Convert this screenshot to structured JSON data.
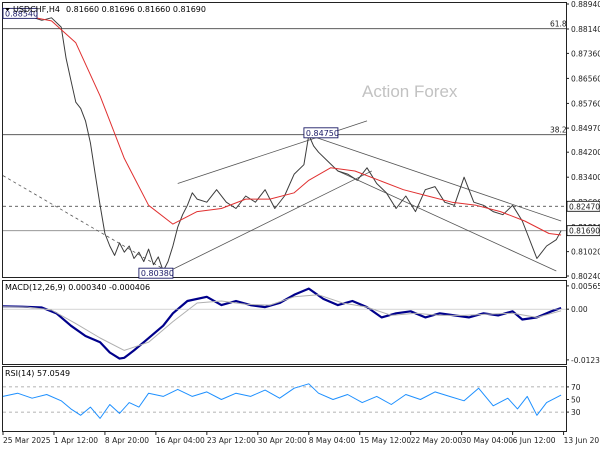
{
  "chart_data": [
    {
      "type": "line",
      "panel": "price",
      "title": "USDCHF,H4",
      "ohlc_readout": "0.81660 0.81696 0.81660 0.81690",
      "watermark": "Action Forex",
      "y_ticks": [
        "0.88940",
        "0.88140",
        "0.87360",
        "0.86560",
        "0.85760",
        "0.84970",
        "0.84200",
        "0.83400",
        "0.82600",
        "0.81810",
        "0.81020",
        "0.80240"
      ],
      "y_ticks_num": [
        0.8894,
        0.8814,
        0.8736,
        0.8656,
        0.8576,
        0.8497,
        0.842,
        0.834,
        0.826,
        0.8181,
        0.8102,
        0.8024
      ],
      "ylim": [
        0.8024,
        0.8894
      ],
      "xlim": [
        0,
        232
      ],
      "x_ticks": [
        "25 Mar 2025",
        "1 Apr 12:00",
        "8 Apr 20:00",
        "16 Apr 04:00",
        "23 Apr 12:00",
        "30 Apr 20:00",
        "8 May 04:00",
        "15 May 12:00",
        "22 May 20:00",
        "30 May 04:00",
        "6 Jun 12:00",
        "13 Jun 20:00"
      ],
      "x_ticks_at": [
        0,
        21,
        42,
        63,
        84,
        105,
        126,
        147,
        168,
        189,
        210,
        231
      ],
      "series": [
        {
          "name": "",
          "color": "#3c3c3c",
          "x": [
            0,
            4,
            8,
            12,
            16,
            20,
            24,
            26,
            28,
            30,
            32,
            34,
            36,
            38,
            40,
            42,
            44,
            46,
            48,
            50,
            52,
            54,
            56,
            58,
            60,
            62,
            64,
            66,
            68,
            70,
            72,
            74,
            76,
            78,
            80,
            84,
            88,
            92,
            96,
            100,
            104,
            108,
            112,
            116,
            120,
            124,
            126,
            128,
            130,
            134,
            138,
            142,
            146,
            150,
            154,
            158,
            162,
            166,
            170,
            174,
            178,
            182,
            186,
            190,
            194,
            198,
            202,
            206,
            210,
            214,
            216,
            220,
            224,
            228,
            230
          ],
          "y": [
            0.8855,
            0.886,
            0.8858,
            0.8852,
            0.8842,
            0.885,
            0.882,
            0.872,
            0.865,
            0.858,
            0.856,
            0.852,
            0.845,
            0.835,
            0.825,
            0.816,
            0.812,
            0.809,
            0.813,
            0.81,
            0.812,
            0.808,
            0.81,
            0.807,
            0.811,
            0.806,
            0.8085,
            0.804,
            0.807,
            0.812,
            0.818,
            0.822,
            0.825,
            0.829,
            0.827,
            0.826,
            0.83,
            0.826,
            0.824,
            0.828,
            0.826,
            0.83,
            0.824,
            0.828,
            0.835,
            0.838,
            0.8475,
            0.844,
            0.842,
            0.839,
            0.836,
            0.835,
            0.833,
            0.837,
            0.832,
            0.829,
            0.824,
            0.828,
            0.823,
            0.83,
            0.831,
            0.826,
            0.825,
            0.834,
            0.826,
            0.825,
            0.823,
            0.822,
            0.825,
            0.82,
            0.816,
            0.808,
            0.812,
            0.814,
            0.8169
          ]
        },
        {
          "name": "",
          "color": "#e03030",
          "x": [
            0,
            10,
            20,
            30,
            40,
            50,
            60,
            70,
            80,
            90,
            100,
            110,
            120,
            126,
            135,
            145,
            155,
            165,
            175,
            185,
            195,
            205,
            215,
            225,
            230
          ],
          "y": [
            0.886,
            0.8855,
            0.884,
            0.877,
            0.86,
            0.84,
            0.825,
            0.819,
            0.823,
            0.824,
            0.827,
            0.827,
            0.829,
            0.833,
            0.837,
            0.836,
            0.833,
            0.83,
            0.828,
            0.826,
            0.825,
            0.823,
            0.82,
            0.816,
            0.8155
          ]
        }
      ],
      "horizontal_lines": [
        {
          "label": "61.8",
          "y": 0.8815,
          "color": "#444444"
        },
        {
          "label": "38.2",
          "y": 0.8476,
          "color": "#444444"
        },
        {
          "label": "0.82470",
          "y": 0.8247,
          "color": "#333333",
          "dashed": true
        },
        {
          "label": "",
          "y": 0.8169,
          "color": "#888888"
        }
      ],
      "price_labels": [
        {
          "text": "0.82470",
          "y": 0.8247,
          "bg": "#ffffff",
          "fg": "#000000"
        },
        {
          "text": "0.81690",
          "y": 0.8169,
          "bg": "#ffffff",
          "fg": "#000000"
        }
      ],
      "boxed_labels": [
        {
          "text": "0.88540",
          "x": 0,
          "y": 0.8864
        },
        {
          "text": "0.84750",
          "x": 124,
          "y": 0.8482
        },
        {
          "text": "0.80380",
          "x": 56,
          "y": 0.8033
        }
      ],
      "trendlines": [
        {
          "x": [
            0,
            68
          ],
          "y": [
            0.8345,
            0.8038
          ],
          "dashed": true
        },
        {
          "x": [
            68,
            152
          ],
          "y": [
            0.8038,
            0.836
          ],
          "dashed": false
        },
        {
          "x": [
            72,
            150
          ],
          "y": [
            0.832,
            0.852
          ],
          "dashed": false
        },
        {
          "x": [
            126,
            230
          ],
          "y": [
            0.8475,
            0.82
          ],
          "dashed": false
        },
        {
          "x": [
            138,
            228
          ],
          "y": [
            0.836,
            0.804
          ],
          "dashed": false
        }
      ]
    },
    {
      "type": "line",
      "panel": "macd",
      "title": "MACD(12,26,9) 0.000340 -0.000406",
      "y_ticks": [
        "0.005659",
        "0.00",
        "-0.012301"
      ],
      "y_ticks_num": [
        0.005659,
        0.0,
        -0.012301
      ],
      "ylim": [
        -0.0133,
        0.0066
      ],
      "xlim": [
        0,
        232
      ],
      "series": [
        {
          "name": "",
          "color": "#00008b",
          "x": [
            0,
            8,
            16,
            22,
            28,
            34,
            40,
            44,
            48,
            50,
            54,
            58,
            62,
            66,
            70,
            76,
            84,
            90,
            96,
            102,
            108,
            114,
            120,
            126,
            132,
            138,
            144,
            150,
            156,
            162,
            168,
            174,
            180,
            186,
            192,
            198,
            204,
            210,
            214,
            220,
            226,
            230
          ],
          "y": [
            0.0007,
            0.0006,
            0.0004,
            -0.001,
            -0.004,
            -0.0065,
            -0.008,
            -0.0105,
            -0.012,
            -0.0118,
            -0.01,
            -0.008,
            -0.006,
            -0.004,
            -0.001,
            0.002,
            0.003,
            0.001,
            0.002,
            0.001,
            0.0005,
            0.0015,
            0.0035,
            0.005,
            0.0025,
            0.001,
            0.002,
            0.0005,
            -0.002,
            -0.001,
            -0.0005,
            -0.002,
            -0.001,
            -0.0015,
            -0.002,
            -0.001,
            -0.0015,
            -0.0005,
            -0.0025,
            -0.002,
            -0.0005,
            0.0003
          ]
        },
        {
          "name": "",
          "color": "#b0b0b0",
          "x": [
            0,
            10,
            20,
            30,
            40,
            50,
            60,
            70,
            80,
            90,
            100,
            110,
            120,
            130,
            140,
            150,
            160,
            170,
            180,
            190,
            200,
            210,
            220,
            230
          ],
          "y": [
            0.0006,
            0.0005,
            -0.0002,
            -0.0035,
            -0.007,
            -0.01,
            -0.008,
            -0.003,
            0.0015,
            0.002,
            0.0012,
            0.001,
            0.003,
            0.0035,
            0.0015,
            0.0005,
            -0.0015,
            -0.001,
            -0.0015,
            -0.0015,
            -0.0012,
            -0.001,
            -0.002,
            -0.0004
          ]
        }
      ]
    },
    {
      "type": "line",
      "panel": "rsi",
      "title": "RSI(14) 57.0549",
      "y_ticks": [
        "70",
        "50",
        "30"
      ],
      "y_ticks_num": [
        70,
        50,
        30
      ],
      "ylim": [
        0,
        100
      ],
      "xlim": [
        0,
        232
      ],
      "levels": [
        70,
        30
      ],
      "series": [
        {
          "name": "",
          "color": "#1e90ff",
          "x": [
            0,
            6,
            12,
            18,
            24,
            28,
            32,
            36,
            40,
            44,
            48,
            52,
            56,
            60,
            66,
            72,
            78,
            84,
            90,
            96,
            102,
            108,
            114,
            120,
            126,
            130,
            136,
            142,
            148,
            154,
            160,
            166,
            172,
            178,
            184,
            190,
            196,
            202,
            208,
            212,
            216,
            220,
            224,
            230
          ],
          "y": [
            55,
            60,
            52,
            58,
            48,
            35,
            25,
            38,
            20,
            42,
            28,
            45,
            38,
            60,
            55,
            66,
            55,
            62,
            50,
            60,
            55,
            65,
            52,
            68,
            75,
            60,
            50,
            58,
            45,
            55,
            42,
            58,
            50,
            62,
            55,
            48,
            68,
            40,
            52,
            35,
            55,
            25,
            45,
            57
          ]
        }
      ]
    }
  ]
}
